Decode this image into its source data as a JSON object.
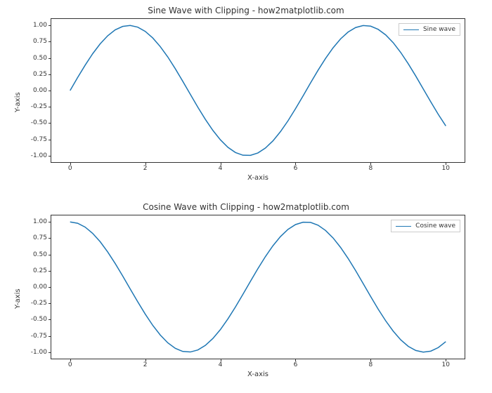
{
  "chart_data": [
    {
      "type": "line",
      "title": "Sine Wave with Clipping - how2matplotlib.com",
      "xlabel": "X-axis",
      "ylabel": "Y-axis",
      "xlim": [
        -0.5,
        10.5
      ],
      "ylim": [
        -1.1,
        1.1
      ],
      "xticks": [
        0,
        2,
        4,
        6,
        8,
        10
      ],
      "yticks": [
        -1.0,
        -0.75,
        -0.5,
        -0.25,
        0.0,
        0.25,
        0.5,
        0.75,
        1.0
      ],
      "legend": {
        "position": "upper right",
        "entries": [
          "Sine wave"
        ]
      },
      "series": [
        {
          "name": "Sine wave",
          "color": "#1f77b4",
          "x": [
            0.0,
            0.2,
            0.4,
            0.6,
            0.8,
            1.0,
            1.2,
            1.4,
            1.6,
            1.8,
            2.0,
            2.2,
            2.4,
            2.6,
            2.8,
            3.0,
            3.2,
            3.4,
            3.6,
            3.8,
            4.0,
            4.2,
            4.4,
            4.6,
            4.8,
            5.0,
            5.2,
            5.4,
            5.6,
            5.8,
            6.0,
            6.2,
            6.4,
            6.6,
            6.8,
            7.0,
            7.2,
            7.4,
            7.6,
            7.8,
            8.0,
            8.2,
            8.4,
            8.6,
            8.8,
            9.0,
            9.2,
            9.4,
            9.6,
            9.8,
            10.0
          ],
          "y": [
            0.0,
            0.199,
            0.389,
            0.565,
            0.717,
            0.841,
            0.932,
            0.985,
            1.0,
            0.974,
            0.909,
            0.808,
            0.675,
            0.516,
            0.335,
            0.141,
            -0.058,
            -0.256,
            -0.443,
            -0.612,
            -0.757,
            -0.872,
            -0.952,
            -0.994,
            -0.996,
            -0.959,
            -0.883,
            -0.773,
            -0.631,
            -0.465,
            -0.279,
            -0.083,
            0.117,
            0.312,
            0.494,
            0.657,
            0.794,
            0.899,
            0.968,
            0.999,
            0.989,
            0.94,
            0.855,
            0.735,
            0.585,
            0.412,
            0.223,
            0.024,
            -0.174,
            -0.367,
            -0.544
          ]
        }
      ]
    },
    {
      "type": "line",
      "title": "Cosine Wave with Clipping - how2matplotlib.com",
      "xlabel": "X-axis",
      "ylabel": "Y-axis",
      "xlim": [
        -0.5,
        10.5
      ],
      "ylim": [
        -1.1,
        1.1
      ],
      "xticks": [
        0,
        2,
        4,
        6,
        8,
        10
      ],
      "yticks": [
        -1.0,
        -0.75,
        -0.5,
        -0.25,
        0.0,
        0.25,
        0.5,
        0.75,
        1.0
      ],
      "legend": {
        "position": "upper right",
        "entries": [
          "Cosine wave"
        ]
      },
      "series": [
        {
          "name": "Cosine wave",
          "color": "#1f77b4",
          "x": [
            0.0,
            0.2,
            0.4,
            0.6,
            0.8,
            1.0,
            1.2,
            1.4,
            1.6,
            1.8,
            2.0,
            2.2,
            2.4,
            2.6,
            2.8,
            3.0,
            3.2,
            3.4,
            3.6,
            3.8,
            4.0,
            4.2,
            4.4,
            4.6,
            4.8,
            5.0,
            5.2,
            5.4,
            5.6,
            5.8,
            6.0,
            6.2,
            6.4,
            6.6,
            6.8,
            7.0,
            7.2,
            7.4,
            7.6,
            7.8,
            8.0,
            8.2,
            8.4,
            8.6,
            8.8,
            9.0,
            9.2,
            9.4,
            9.6,
            9.8,
            10.0
          ],
          "y": [
            1.0,
            0.98,
            0.921,
            0.825,
            0.697,
            0.54,
            0.362,
            0.17,
            -0.029,
            -0.227,
            -0.416,
            -0.589,
            -0.737,
            -0.857,
            -0.942,
            -0.99,
            -0.998,
            -0.967,
            -0.897,
            -0.791,
            -0.654,
            -0.49,
            -0.307,
            -0.112,
            0.087,
            0.284,
            0.469,
            0.635,
            0.776,
            0.886,
            0.96,
            0.996,
            0.993,
            0.95,
            0.869,
            0.754,
            0.608,
            0.439,
            0.252,
            0.054,
            -0.146,
            -0.34,
            -0.519,
            -0.678,
            -0.811,
            -0.911,
            -0.975,
            -1.0,
            -0.985,
            -0.93,
            -0.839
          ]
        }
      ]
    }
  ],
  "subplots": [
    {
      "title": "Sine Wave with Clipping - how2matplotlib.com",
      "legend_label": "Sine wave",
      "xlabel": "X-axis",
      "ylabel": "Y-axis"
    },
    {
      "title": "Cosine Wave with Clipping - how2matplotlib.com",
      "legend_label": "Cosine wave",
      "xlabel": "X-axis",
      "ylabel": "Y-axis"
    }
  ],
  "xtick_labels": [
    "0",
    "2",
    "4",
    "6",
    "8",
    "10"
  ],
  "ytick_labels": [
    "-1.00",
    "-0.75",
    "-0.50",
    "-0.25",
    "0.00",
    "0.25",
    "0.50",
    "0.75",
    "1.00"
  ]
}
